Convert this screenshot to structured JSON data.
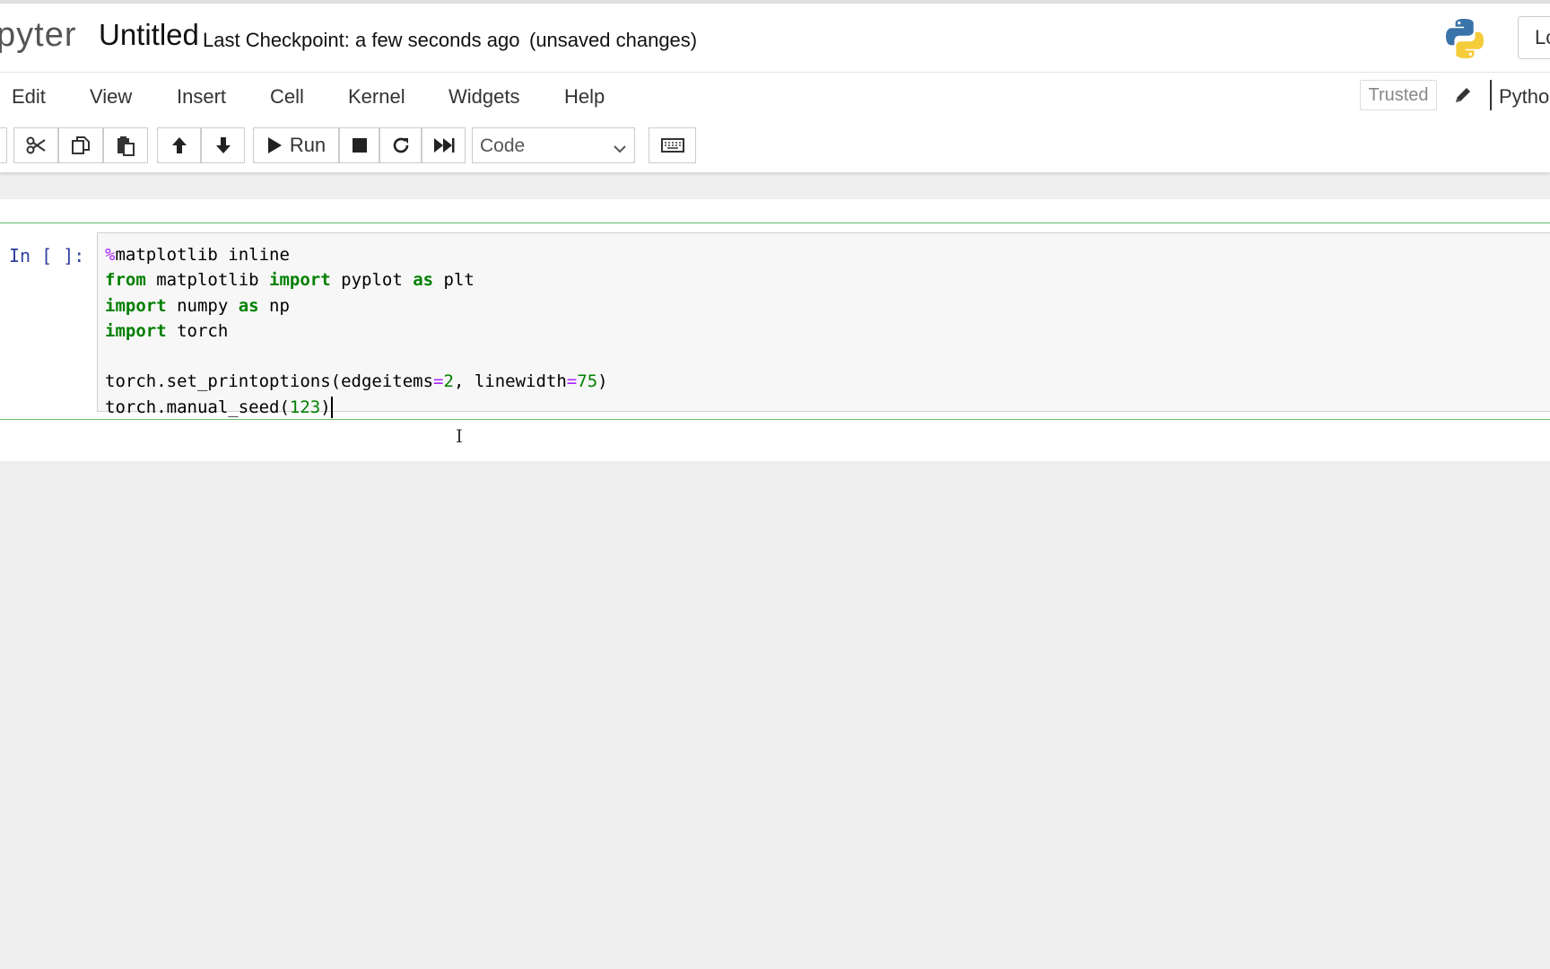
{
  "header": {
    "logo_text": "pyter",
    "notebook_name": "Untitled",
    "checkpoint": "Last Checkpoint: a few seconds ago",
    "unsaved": "(unsaved changes)",
    "logout_label": "Lo"
  },
  "menu": {
    "items": [
      "Edit",
      "View",
      "Insert",
      "Cell",
      "Kernel",
      "Widgets",
      "Help"
    ],
    "trusted": "Trusted",
    "kernel_name": "Pytho"
  },
  "toolbar": {
    "run_label": "Run",
    "cell_type": "Code",
    "icons": [
      "cut-icon",
      "copy-icon",
      "paste-icon",
      "move-up-icon",
      "move-down-icon",
      "run-icon",
      "stop-icon",
      "restart-icon",
      "fast-forward-icon",
      "keyboard-icon"
    ]
  },
  "cell": {
    "prompt": "In [ ]:",
    "code_lines": [
      "%matplotlib inline",
      "from matplotlib import pyplot as plt",
      "import numpy as np",
      "import torch",
      "",
      "torch.set_printoptions(edgeitems=2, linewidth=75)",
      "torch.manual_seed(123)"
    ]
  },
  "colors": {
    "keyword": "#008000",
    "magic": "#aa22ff",
    "prompt": "#303f9f",
    "cell_border": "#66bb6a"
  }
}
